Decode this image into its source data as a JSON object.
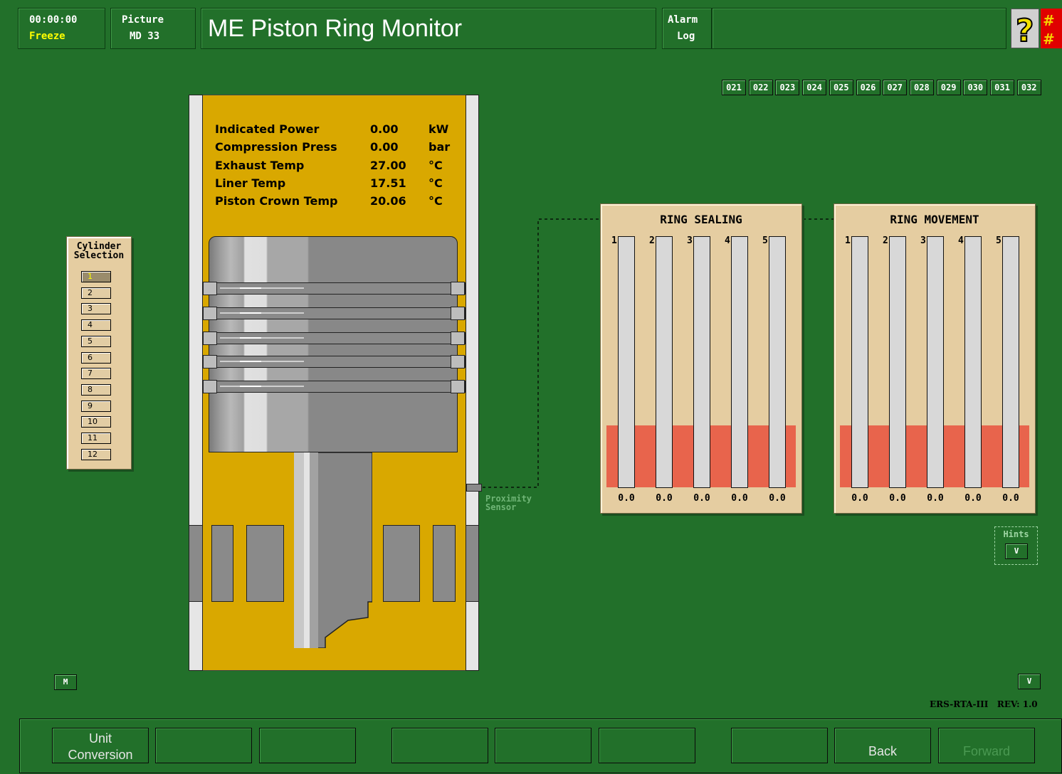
{
  "header": {
    "clock": "00:00:00",
    "freeze_label": "Freeze",
    "picture_label": "Picture",
    "picture_id": "MD 33",
    "title": "ME Piston Ring Monitor",
    "alarm_label": "Alarm",
    "log_label": "Log",
    "help_icon": "question-mark-icon",
    "language_icon": "chinese-language-icon"
  },
  "page_buttons": [
    "021",
    "022",
    "023",
    "024",
    "025",
    "026",
    "027",
    "028",
    "029",
    "030",
    "031",
    "032"
  ],
  "cylinder_selection": {
    "title_line1": "Cylinder",
    "title_line2": "Selection",
    "items": [
      "1",
      "2",
      "3",
      "4",
      "5",
      "6",
      "7",
      "8",
      "9",
      "10",
      "11",
      "12"
    ],
    "selected": "1"
  },
  "parameters": [
    {
      "label": "Indicated Power",
      "value": "0.00",
      "unit": "kW"
    },
    {
      "label": "Compression Press",
      "value": "0.00",
      "unit": "bar"
    },
    {
      "label": "Exhaust Temp",
      "value": "27.00",
      "unit": "°C"
    },
    {
      "label": "Liner Temp",
      "value": "17.51",
      "unit": "°C"
    },
    {
      "label": "Piston Crown Temp",
      "value": "20.06",
      "unit": "°C"
    }
  ],
  "proximity_sensor": {
    "line1": "Proximity",
    "line2": "Sensor"
  },
  "ring_sealing": {
    "title": "RING SEALING",
    "rings": [
      "1",
      "2",
      "3",
      "4",
      "5"
    ],
    "values": [
      "0.0",
      "0.0",
      "0.0",
      "0.0",
      "0.0"
    ]
  },
  "ring_movement": {
    "title": "RING MOVEMENT",
    "rings": [
      "1",
      "2",
      "3",
      "4",
      "5"
    ],
    "values": [
      "0.0",
      "0.0",
      "0.0",
      "0.0",
      "0.0"
    ]
  },
  "hints": {
    "label": "Hints",
    "button": "V"
  },
  "m_button": "M",
  "v_button": "V",
  "footer_rev": {
    "system": "ERS-RTA-III",
    "rev": "REV: 1.0"
  },
  "footer": {
    "unit_conversion_1": "Unit",
    "unit_conversion_2": "Conversion",
    "back": "Back",
    "forward": "Forward"
  },
  "colors": {
    "background": "#22702a",
    "piston_housing": "#d9a800",
    "panel": "#e5cda1",
    "alarm_band": "#e8644c"
  }
}
